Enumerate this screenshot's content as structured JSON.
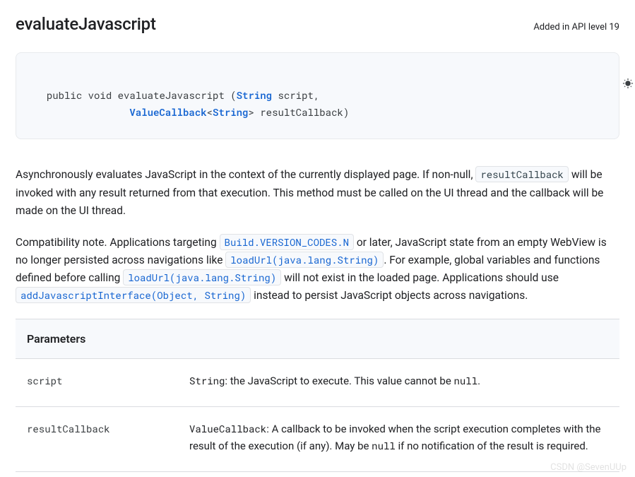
{
  "header": {
    "method_name": "evaluateJavascript",
    "api_level": "Added in API level 19"
  },
  "signature": {
    "prefix": "public void evaluateJavascript (",
    "type_string": "String",
    "param1": " script, ",
    "indent": "                ",
    "type_valuecallback": "ValueCallback",
    "lt": "<",
    "type_string2": "String",
    "gt": "> resultCallback)"
  },
  "description": {
    "p1a": "Asynchronously evaluates JavaScript in the context of the currently displayed page. If non-null, ",
    "p1_code": "resultCallback",
    "p1b": " will be invoked with any result returned from that execution. This method must be called on the UI thread and the callback will be made on the UI thread.",
    "p2a": "Compatibility note. Applications targeting ",
    "p2_code1": "Build.VERSION_CODES.N",
    "p2b": " or later, JavaScript state from an empty WebView is no longer persisted across navigations like ",
    "p2_code2": "loadUrl(java.lang.String)",
    "p2c": ". For example, global variables and functions defined before calling ",
    "p2_code3": "loadUrl(java.lang.String)",
    "p2d": " will not exist in the loaded page. Applications should use ",
    "p2_code4": "addJavascriptInterface(Object, String)",
    "p2e": " instead to persist JavaScript objects across navigations."
  },
  "params_table": {
    "header": "Parameters",
    "rows": [
      {
        "name": "script",
        "type": "String",
        "desc1": ": the JavaScript to execute. This value cannot be ",
        "code1": "null",
        "desc2": "."
      },
      {
        "name": "resultCallback",
        "type": "ValueCallback",
        "desc1": ": A callback to be invoked when the script execution completes with the result of the execution (if any). May be ",
        "code1": "null",
        "desc2": " if no notification of the result is required."
      }
    ]
  },
  "watermark": "CSDN @SevenUUp"
}
